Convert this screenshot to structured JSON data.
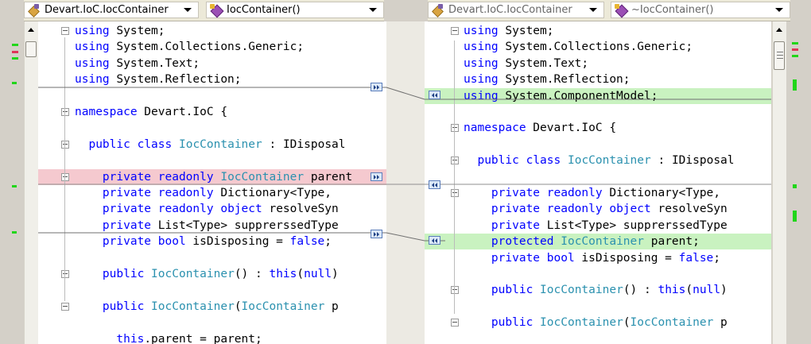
{
  "left_pane": {
    "class_selector": "Devart.IoC.IocContainer",
    "member_selector": "IocContainer()",
    "lines": [
      [
        {
          "t": "using",
          "c": "kw"
        },
        {
          "t": " System;"
        }
      ],
      [
        {
          "t": "using",
          "c": "kw"
        },
        {
          "t": " System.Collections.Generic;"
        }
      ],
      [
        {
          "t": "using",
          "c": "kw"
        },
        {
          "t": " System.Text;"
        }
      ],
      [
        {
          "t": "using",
          "c": "kw"
        },
        {
          "t": " System.Reflection;"
        }
      ],
      [],
      [
        {
          "t": "namespace",
          "c": "kw"
        },
        {
          "t": " Devart.IoC {"
        }
      ],
      [],
      [
        {
          "t": "  "
        },
        {
          "t": "public",
          "c": "kw"
        },
        {
          "t": " "
        },
        {
          "t": "class",
          "c": "kw"
        },
        {
          "t": " "
        },
        {
          "t": "IocContainer",
          "c": "ty"
        },
        {
          "t": " : IDisposal"
        }
      ],
      [],
      [
        {
          "t": "    "
        },
        {
          "t": "private",
          "c": "kw"
        },
        {
          "t": " "
        },
        {
          "t": "readonly",
          "c": "kw"
        },
        {
          "t": " "
        },
        {
          "t": "IocContainer",
          "c": "ty"
        },
        {
          "t": " parent"
        }
      ],
      [
        {
          "t": "    "
        },
        {
          "t": "private",
          "c": "kw"
        },
        {
          "t": " "
        },
        {
          "t": "readonly",
          "c": "kw"
        },
        {
          "t": " Dictionary<Type,"
        }
      ],
      [
        {
          "t": "    "
        },
        {
          "t": "private",
          "c": "kw"
        },
        {
          "t": " "
        },
        {
          "t": "readonly",
          "c": "kw"
        },
        {
          "t": " "
        },
        {
          "t": "object",
          "c": "kw"
        },
        {
          "t": " resolveSyn"
        }
      ],
      [
        {
          "t": "    "
        },
        {
          "t": "private",
          "c": "kw"
        },
        {
          "t": " List<Type> supprerssedType"
        }
      ],
      [
        {
          "t": "    "
        },
        {
          "t": "private",
          "c": "kw"
        },
        {
          "t": " "
        },
        {
          "t": "bool",
          "c": "kw"
        },
        {
          "t": " isDisposing = "
        },
        {
          "t": "false",
          "c": "kw"
        },
        {
          "t": ";"
        }
      ],
      [],
      [
        {
          "t": "    "
        },
        {
          "t": "public",
          "c": "kw"
        },
        {
          "t": " "
        },
        {
          "t": "IocContainer",
          "c": "ty"
        },
        {
          "t": "() : "
        },
        {
          "t": "this",
          "c": "kw"
        },
        {
          "t": "("
        },
        {
          "t": "null",
          "c": "kw"
        },
        {
          "t": ")"
        }
      ],
      [],
      [
        {
          "t": "    "
        },
        {
          "t": "public",
          "c": "kw"
        },
        {
          "t": " "
        },
        {
          "t": "IocContainer",
          "c": "ty"
        },
        {
          "t": "("
        },
        {
          "t": "IocContainer",
          "c": "ty"
        },
        {
          "t": " p"
        }
      ],
      [],
      [
        {
          "t": "      "
        },
        {
          "t": "this",
          "c": "kw"
        },
        {
          "t": ".parent = parent;"
        }
      ]
    ]
  },
  "right_pane": {
    "class_selector": "Devart.IoC.IocContainer",
    "member_selector": "~IocContainer()",
    "lines": [
      [
        {
          "t": "using",
          "c": "kw"
        },
        {
          "t": " System;"
        }
      ],
      [
        {
          "t": "using",
          "c": "kw"
        },
        {
          "t": " System.Collections.Generic;"
        }
      ],
      [
        {
          "t": "using",
          "c": "kw"
        },
        {
          "t": " System.Text;"
        }
      ],
      [
        {
          "t": "using",
          "c": "kw"
        },
        {
          "t": " System.Reflection;"
        }
      ],
      [
        {
          "t": "using",
          "c": "kw"
        },
        {
          "t": " System.ComponentModel;"
        }
      ],
      [],
      [
        {
          "t": "namespace",
          "c": "kw"
        },
        {
          "t": " Devart.IoC {"
        }
      ],
      [],
      [
        {
          "t": "  "
        },
        {
          "t": "public",
          "c": "kw"
        },
        {
          "t": " "
        },
        {
          "t": "class",
          "c": "kw"
        },
        {
          "t": " "
        },
        {
          "t": "IocContainer",
          "c": "ty"
        },
        {
          "t": " : IDisposal"
        }
      ],
      [],
      [
        {
          "t": "    "
        },
        {
          "t": "private",
          "c": "kw"
        },
        {
          "t": " "
        },
        {
          "t": "readonly",
          "c": "kw"
        },
        {
          "t": " Dictionary<Type,"
        }
      ],
      [
        {
          "t": "    "
        },
        {
          "t": "private",
          "c": "kw"
        },
        {
          "t": " "
        },
        {
          "t": "readonly",
          "c": "kw"
        },
        {
          "t": " "
        },
        {
          "t": "object",
          "c": "kw"
        },
        {
          "t": " resolveSyn"
        }
      ],
      [
        {
          "t": "    "
        },
        {
          "t": "private",
          "c": "kw"
        },
        {
          "t": " List<Type> supprerssedType"
        }
      ],
      [
        {
          "t": "    "
        },
        {
          "t": "protected",
          "c": "kw"
        },
        {
          "t": " "
        },
        {
          "t": "IocContainer",
          "c": "ty"
        },
        {
          "t": " parent;"
        }
      ],
      [
        {
          "t": "    "
        },
        {
          "t": "private",
          "c": "kw"
        },
        {
          "t": " "
        },
        {
          "t": "bool",
          "c": "kw"
        },
        {
          "t": " isDisposing = "
        },
        {
          "t": "false",
          "c": "kw"
        },
        {
          "t": ";"
        }
      ],
      [],
      [
        {
          "t": "    "
        },
        {
          "t": "public",
          "c": "kw"
        },
        {
          "t": " "
        },
        {
          "t": "IocContainer",
          "c": "ty"
        },
        {
          "t": "() : "
        },
        {
          "t": "this",
          "c": "kw"
        },
        {
          "t": "("
        },
        {
          "t": "null",
          "c": "kw"
        },
        {
          "t": ")"
        }
      ],
      [],
      [
        {
          "t": "    "
        },
        {
          "t": "public",
          "c": "kw"
        },
        {
          "t": " "
        },
        {
          "t": "IocContainer",
          "c": "ty"
        },
        {
          "t": "("
        },
        {
          "t": "IocContainer",
          "c": "ty"
        },
        {
          "t": " p"
        }
      ]
    ]
  },
  "colors": {
    "keyword": "#0000ff",
    "type": "#2b91af",
    "removed_line": "#f5c9cf",
    "added_line": "#c9f2c0",
    "nav_button": "#dbe8f7",
    "gutter_added": "#21d61a",
    "gutter_removed": "#e0345a"
  }
}
